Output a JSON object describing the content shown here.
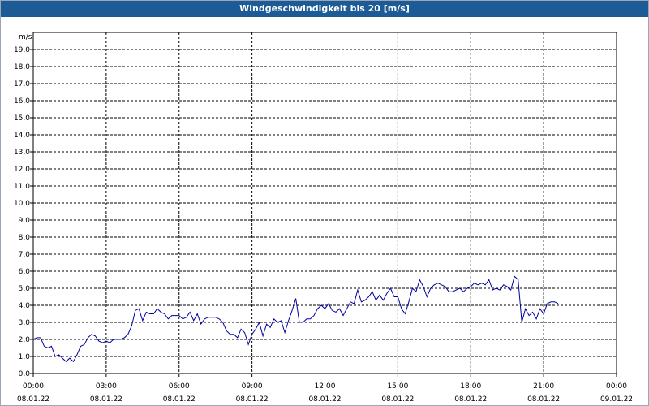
{
  "colors": {
    "title_bar": "#1c5b95",
    "line": "#0000a0",
    "grid": "#000000",
    "background": "#ffffff"
  },
  "chart_data": {
    "type": "line",
    "title": "Windgeschwindigkeit bis 20 [m/s]",
    "unit_label": "m/s",
    "ylim": [
      0,
      20
    ],
    "y_ticks": [
      "0,0",
      "1,0",
      "2,0",
      "3,0",
      "4,0",
      "5,0",
      "6,0",
      "7,0",
      "8,0",
      "9,0",
      "10,0",
      "11,0",
      "12,0",
      "13,0",
      "14,0",
      "15,0",
      "16,0",
      "17,0",
      "18,0",
      "19,0"
    ],
    "x_range_hours": [
      0,
      24
    ],
    "x_ticks": [
      {
        "time": "00:00",
        "date": "08.01.22"
      },
      {
        "time": "03:00",
        "date": "08.01.22"
      },
      {
        "time": "06:00",
        "date": "08.01.22"
      },
      {
        "time": "09:00",
        "date": "08.01.22"
      },
      {
        "time": "12:00",
        "date": "08.01.22"
      },
      {
        "time": "15:00",
        "date": "08.01.22"
      },
      {
        "time": "18:00",
        "date": "08.01.22"
      },
      {
        "time": "21:00",
        "date": "08.01.22"
      },
      {
        "time": "00:00",
        "date": "09.01.22"
      }
    ],
    "grid": true,
    "series": [
      {
        "values": [
          [
            0.0,
            2.0
          ],
          [
            0.15,
            2.1
          ],
          [
            0.3,
            2.1
          ],
          [
            0.45,
            1.6
          ],
          [
            0.6,
            1.5
          ],
          [
            0.75,
            1.6
          ],
          [
            0.9,
            1.0
          ],
          [
            1.05,
            1.1
          ],
          [
            1.2,
            0.9
          ],
          [
            1.35,
            0.7
          ],
          [
            1.5,
            0.9
          ],
          [
            1.65,
            0.7
          ],
          [
            1.8,
            1.1
          ],
          [
            1.95,
            1.6
          ],
          [
            2.1,
            1.7
          ],
          [
            2.25,
            2.1
          ],
          [
            2.4,
            2.3
          ],
          [
            2.55,
            2.2
          ],
          [
            2.7,
            1.9
          ],
          [
            2.85,
            1.8
          ],
          [
            3.0,
            1.9
          ],
          [
            3.15,
            1.8
          ],
          [
            3.3,
            2.0
          ],
          [
            3.45,
            2.0
          ],
          [
            3.6,
            2.0
          ],
          [
            3.75,
            2.1
          ],
          [
            3.9,
            2.3
          ],
          [
            4.05,
            2.8
          ],
          [
            4.2,
            3.7
          ],
          [
            4.35,
            3.8
          ],
          [
            4.5,
            3.1
          ],
          [
            4.65,
            3.6
          ],
          [
            4.8,
            3.5
          ],
          [
            4.95,
            3.5
          ],
          [
            5.1,
            3.8
          ],
          [
            5.25,
            3.6
          ],
          [
            5.4,
            3.5
          ],
          [
            5.55,
            3.2
          ],
          [
            5.7,
            3.4
          ],
          [
            5.85,
            3.4
          ],
          [
            6.0,
            3.4
          ],
          [
            6.15,
            3.2
          ],
          [
            6.3,
            3.3
          ],
          [
            6.45,
            3.6
          ],
          [
            6.6,
            3.1
          ],
          [
            6.75,
            3.5
          ],
          [
            6.9,
            2.9
          ],
          [
            7.05,
            3.2
          ],
          [
            7.2,
            3.3
          ],
          [
            7.35,
            3.3
          ],
          [
            7.5,
            3.3
          ],
          [
            7.65,
            3.2
          ],
          [
            7.8,
            3.0
          ],
          [
            7.95,
            2.5
          ],
          [
            8.1,
            2.3
          ],
          [
            8.25,
            2.3
          ],
          [
            8.4,
            2.1
          ],
          [
            8.55,
            2.6
          ],
          [
            8.7,
            2.4
          ],
          [
            8.85,
            1.7
          ],
          [
            9.0,
            2.3
          ],
          [
            9.15,
            2.6
          ],
          [
            9.3,
            3.0
          ],
          [
            9.45,
            2.2
          ],
          [
            9.6,
            2.9
          ],
          [
            9.75,
            2.7
          ],
          [
            9.9,
            3.2
          ],
          [
            10.05,
            3.0
          ],
          [
            10.2,
            3.1
          ],
          [
            10.35,
            2.4
          ],
          [
            10.5,
            3.1
          ],
          [
            10.65,
            3.7
          ],
          [
            10.8,
            4.4
          ],
          [
            10.95,
            3.0
          ],
          [
            11.1,
            3.0
          ],
          [
            11.25,
            3.2
          ],
          [
            11.4,
            3.2
          ],
          [
            11.55,
            3.4
          ],
          [
            11.7,
            3.8
          ],
          [
            11.85,
            4.0
          ],
          [
            12.0,
            3.8
          ],
          [
            12.15,
            4.1
          ],
          [
            12.3,
            3.7
          ],
          [
            12.45,
            3.6
          ],
          [
            12.6,
            3.8
          ],
          [
            12.75,
            3.4
          ],
          [
            12.9,
            3.8
          ],
          [
            13.05,
            4.2
          ],
          [
            13.2,
            4.1
          ],
          [
            13.35,
            4.9
          ],
          [
            13.5,
            4.2
          ],
          [
            13.65,
            4.3
          ],
          [
            13.8,
            4.5
          ],
          [
            13.95,
            4.8
          ],
          [
            14.1,
            4.3
          ],
          [
            14.25,
            4.6
          ],
          [
            14.4,
            4.3
          ],
          [
            14.55,
            4.7
          ],
          [
            14.7,
            5.0
          ],
          [
            14.85,
            4.5
          ],
          [
            15.0,
            4.5
          ],
          [
            15.15,
            3.8
          ],
          [
            15.3,
            3.5
          ],
          [
            15.45,
            4.2
          ],
          [
            15.6,
            5.0
          ],
          [
            15.75,
            4.8
          ],
          [
            15.9,
            5.5
          ],
          [
            16.05,
            5.1
          ],
          [
            16.2,
            4.5
          ],
          [
            16.35,
            5.0
          ],
          [
            16.5,
            5.2
          ],
          [
            16.65,
            5.3
          ],
          [
            16.8,
            5.2
          ],
          [
            16.95,
            5.1
          ],
          [
            17.1,
            4.8
          ],
          [
            17.25,
            4.8
          ],
          [
            17.4,
            4.9
          ],
          [
            17.55,
            5.0
          ],
          [
            17.7,
            4.8
          ],
          [
            17.85,
            5.0
          ],
          [
            18.0,
            5.1
          ],
          [
            18.15,
            5.3
          ],
          [
            18.3,
            5.2
          ],
          [
            18.45,
            5.3
          ],
          [
            18.6,
            5.2
          ],
          [
            18.75,
            5.5
          ],
          [
            18.9,
            4.9
          ],
          [
            19.05,
            5.0
          ],
          [
            19.2,
            4.9
          ],
          [
            19.35,
            5.2
          ],
          [
            19.5,
            5.1
          ],
          [
            19.65,
            4.9
          ],
          [
            19.8,
            5.7
          ],
          [
            19.95,
            5.5
          ],
          [
            20.1,
            3.0
          ],
          [
            20.25,
            3.8
          ],
          [
            20.4,
            3.4
          ],
          [
            20.55,
            3.6
          ],
          [
            20.7,
            3.2
          ],
          [
            20.85,
            3.8
          ],
          [
            21.0,
            3.5
          ],
          [
            21.15,
            4.1
          ],
          [
            21.3,
            4.2
          ],
          [
            21.45,
            4.2
          ],
          [
            21.6,
            4.1
          ]
        ]
      }
    ]
  }
}
